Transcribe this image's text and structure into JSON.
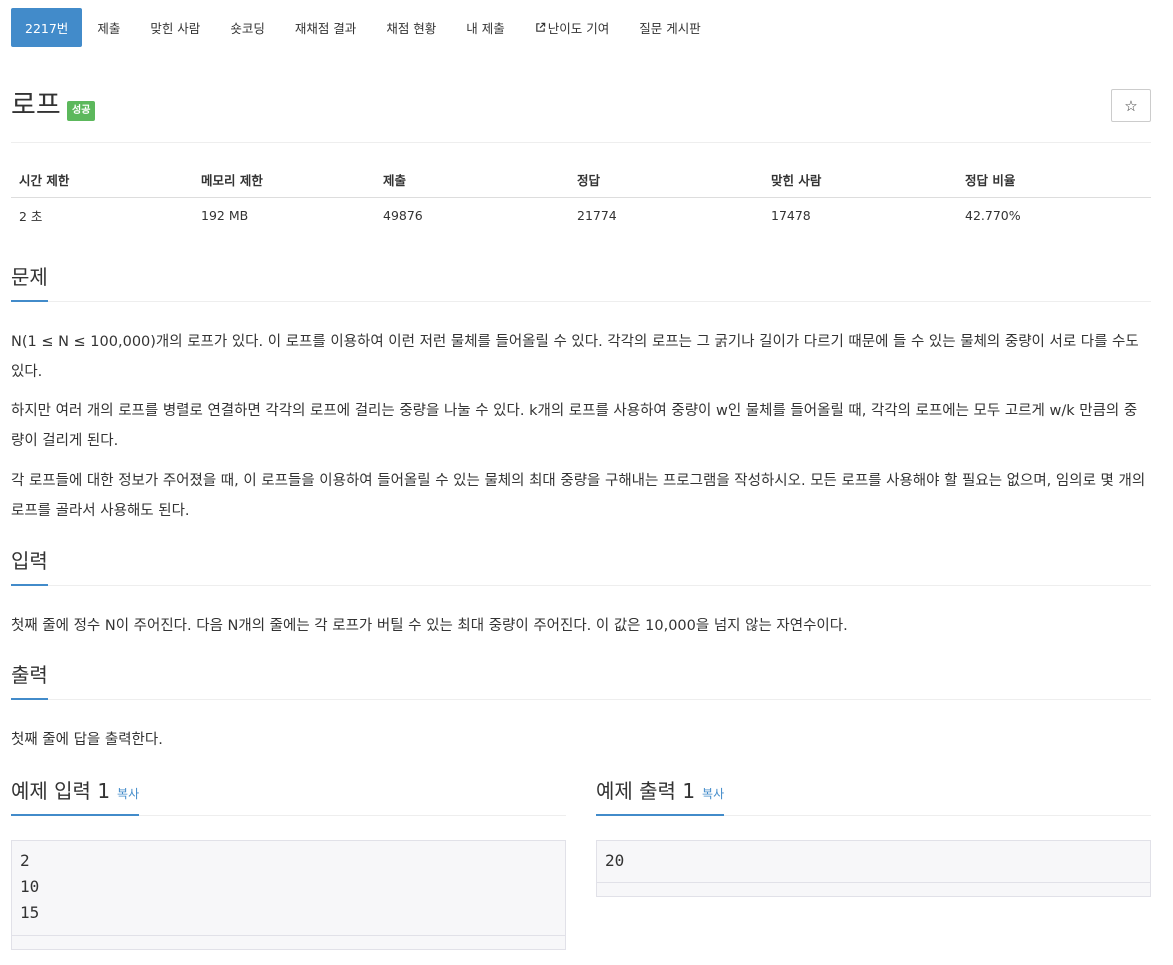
{
  "tabs": [
    {
      "label": "2217번",
      "active": true
    },
    {
      "label": "제출"
    },
    {
      "label": "맞힌 사람"
    },
    {
      "label": "숏코딩"
    },
    {
      "label": "재채점 결과"
    },
    {
      "label": "채점 현황"
    },
    {
      "label": "내 제출"
    },
    {
      "label": "난이도 기여",
      "icon": "external-link-icon"
    },
    {
      "label": "질문 게시판"
    }
  ],
  "problem": {
    "title": "로프",
    "badge": "성공",
    "badge_color": "#5cb85c",
    "star_icon": "☆"
  },
  "info_table": {
    "headers": [
      "시간 제한",
      "메모리 제한",
      "제출",
      "정답",
      "맞힌 사람",
      "정답 비율"
    ],
    "row": [
      "2 초",
      "192 MB",
      "49876",
      "21774",
      "17478",
      "42.770%"
    ]
  },
  "sections": {
    "description": {
      "heading": "문제",
      "paragraphs": [
        "N(1 ≤ N ≤ 100,000)개의 로프가 있다. 이 로프를 이용하여 이런 저런 물체를 들어올릴 수 있다. 각각의 로프는 그 굵기나 길이가 다르기 때문에 들 수 있는 물체의 중량이 서로 다를 수도 있다.",
        "하지만 여러 개의 로프를 병렬로 연결하면 각각의 로프에 걸리는 중량을 나눌 수 있다. k개의 로프를 사용하여 중량이 w인 물체를 들어올릴 때, 각각의 로프에는 모두 고르게 w/k 만큼의 중량이 걸리게 된다.",
        "각 로프들에 대한 정보가 주어졌을 때, 이 로프들을 이용하여 들어올릴 수 있는 물체의 최대 중량을 구해내는 프로그램을 작성하시오. 모든 로프를 사용해야 할 필요는 없으며, 임의로 몇 개의 로프를 골라서 사용해도 된다."
      ]
    },
    "input": {
      "heading": "입력",
      "text": "첫째 줄에 정수 N이 주어진다. 다음 N개의 줄에는 각 로프가 버틸 수 있는 최대 중량이 주어진다. 이 값은 10,000을 넘지 않는 자연수이다."
    },
    "output": {
      "heading": "출력",
      "text": "첫째 줄에 답을 출력한다."
    }
  },
  "samples": {
    "input": {
      "heading": "예제 입력 1",
      "copy": "복사",
      "content": "2\n10\n15"
    },
    "output": {
      "heading": "예제 출력 1",
      "copy": "복사",
      "content": "20"
    }
  },
  "colors": {
    "accent": "#428bca",
    "success": "#5cb85c"
  }
}
